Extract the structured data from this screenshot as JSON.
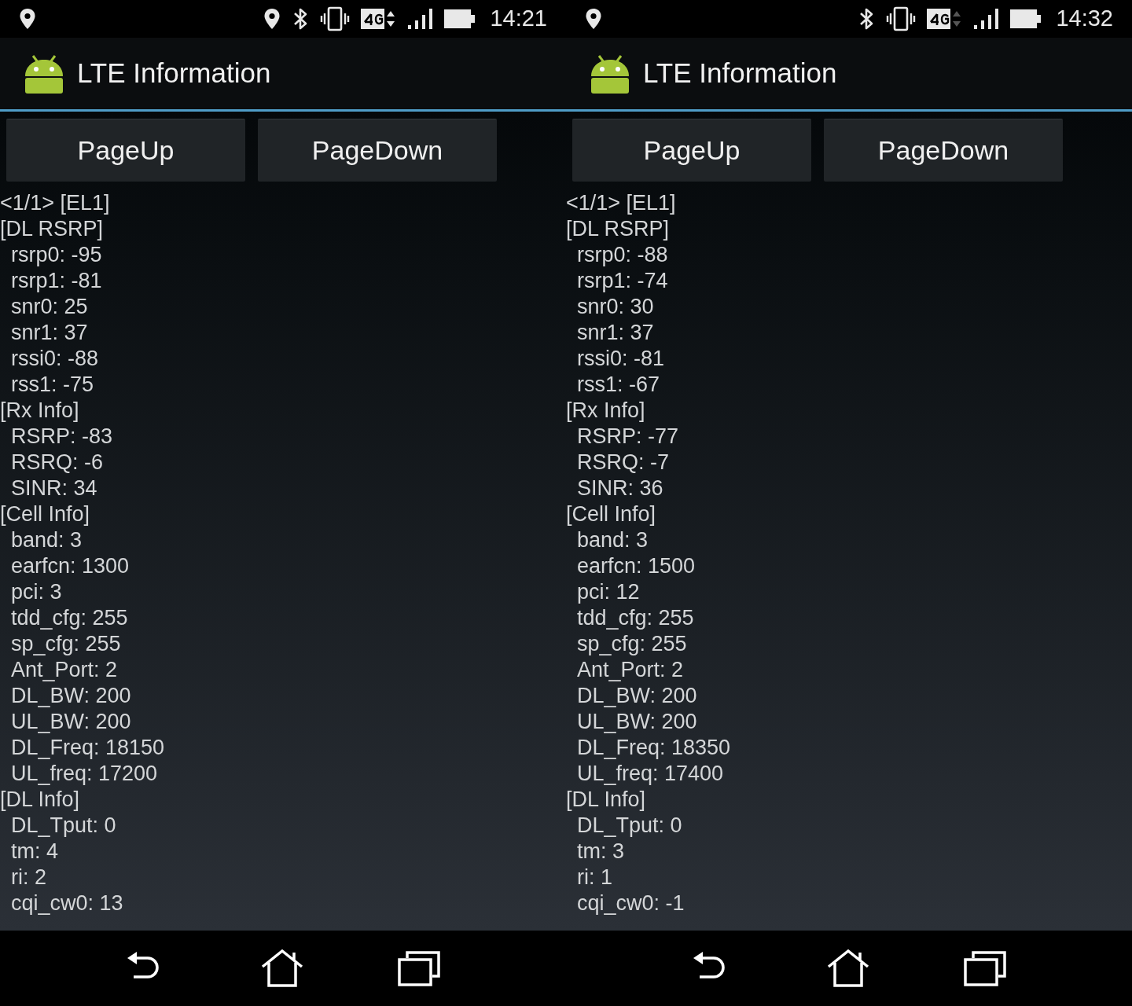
{
  "screens": [
    {
      "status_bar": {
        "time": "14:21",
        "location_active": true,
        "data_activity": true
      },
      "app_bar": {
        "title": "LTE Information"
      },
      "buttons": [
        "PageUp",
        "PageDown"
      ],
      "lines": [
        {
          "kind": "header",
          "text": "<1/1> [EL1]"
        },
        {
          "kind": "header",
          "text": "[DL RSRP]"
        },
        {
          "kind": "value",
          "text": "rsrp0: -95"
        },
        {
          "kind": "value",
          "text": "rsrp1: -81"
        },
        {
          "kind": "value",
          "text": "snr0: 25"
        },
        {
          "kind": "value",
          "text": "snr1: 37"
        },
        {
          "kind": "value",
          "text": "rssi0: -88"
        },
        {
          "kind": "value",
          "text": "rss1: -75"
        },
        {
          "kind": "header",
          "text": "[Rx Info]"
        },
        {
          "kind": "value",
          "text": "RSRP: -83"
        },
        {
          "kind": "value",
          "text": "RSRQ: -6"
        },
        {
          "kind": "value",
          "text": "SINR: 34"
        },
        {
          "kind": "header",
          "text": "[Cell Info]"
        },
        {
          "kind": "value",
          "text": "band: 3"
        },
        {
          "kind": "value",
          "text": "earfcn: 1300"
        },
        {
          "kind": "value",
          "text": "pci: 3"
        },
        {
          "kind": "value",
          "text": "tdd_cfg: 255"
        },
        {
          "kind": "value",
          "text": "sp_cfg: 255"
        },
        {
          "kind": "value",
          "text": "Ant_Port: 2"
        },
        {
          "kind": "value",
          "text": "DL_BW: 200"
        },
        {
          "kind": "value",
          "text": "UL_BW: 200"
        },
        {
          "kind": "value",
          "text": "DL_Freq: 18150"
        },
        {
          "kind": "value",
          "text": "UL_freq: 17200"
        },
        {
          "kind": "header",
          "text": "[DL Info]"
        },
        {
          "kind": "value",
          "text": "DL_Tput: 0"
        },
        {
          "kind": "value",
          "text": "tm: 4"
        },
        {
          "kind": "value",
          "text": "ri: 2"
        },
        {
          "kind": "value",
          "text": "cqi_cw0: 13"
        }
      ]
    },
    {
      "status_bar": {
        "time": "14:32",
        "location_active": false,
        "data_activity": false
      },
      "app_bar": {
        "title": "LTE Information"
      },
      "buttons": [
        "PageUp",
        "PageDown"
      ],
      "lines": [
        {
          "kind": "header",
          "text": "<1/1> [EL1]"
        },
        {
          "kind": "header",
          "text": "[DL RSRP]"
        },
        {
          "kind": "value",
          "text": "rsrp0: -88"
        },
        {
          "kind": "value",
          "text": "rsrp1: -74"
        },
        {
          "kind": "value",
          "text": "snr0: 30"
        },
        {
          "kind": "value",
          "text": "snr1: 37"
        },
        {
          "kind": "value",
          "text": "rssi0: -81"
        },
        {
          "kind": "value",
          "text": "rss1: -67"
        },
        {
          "kind": "header",
          "text": "[Rx Info]"
        },
        {
          "kind": "value",
          "text": "RSRP: -77"
        },
        {
          "kind": "value",
          "text": "RSRQ: -7"
        },
        {
          "kind": "value",
          "text": "SINR: 36"
        },
        {
          "kind": "header",
          "text": "[Cell Info]"
        },
        {
          "kind": "value",
          "text": "band: 3"
        },
        {
          "kind": "value",
          "text": "earfcn: 1500"
        },
        {
          "kind": "value",
          "text": "pci: 12"
        },
        {
          "kind": "value",
          "text": "tdd_cfg: 255"
        },
        {
          "kind": "value",
          "text": "sp_cfg: 255"
        },
        {
          "kind": "value",
          "text": "Ant_Port: 2"
        },
        {
          "kind": "value",
          "text": "DL_BW: 200"
        },
        {
          "kind": "value",
          "text": "UL_BW: 200"
        },
        {
          "kind": "value",
          "text": "DL_Freq: 18350"
        },
        {
          "kind": "value",
          "text": "UL_freq: 17400"
        },
        {
          "kind": "header",
          "text": "[DL Info]"
        },
        {
          "kind": "value",
          "text": "DL_Tput: 0"
        },
        {
          "kind": "value",
          "text": "tm: 3"
        },
        {
          "kind": "value",
          "text": "ri: 1"
        },
        {
          "kind": "value",
          "text": "cqi_cw0: -1"
        }
      ]
    }
  ]
}
